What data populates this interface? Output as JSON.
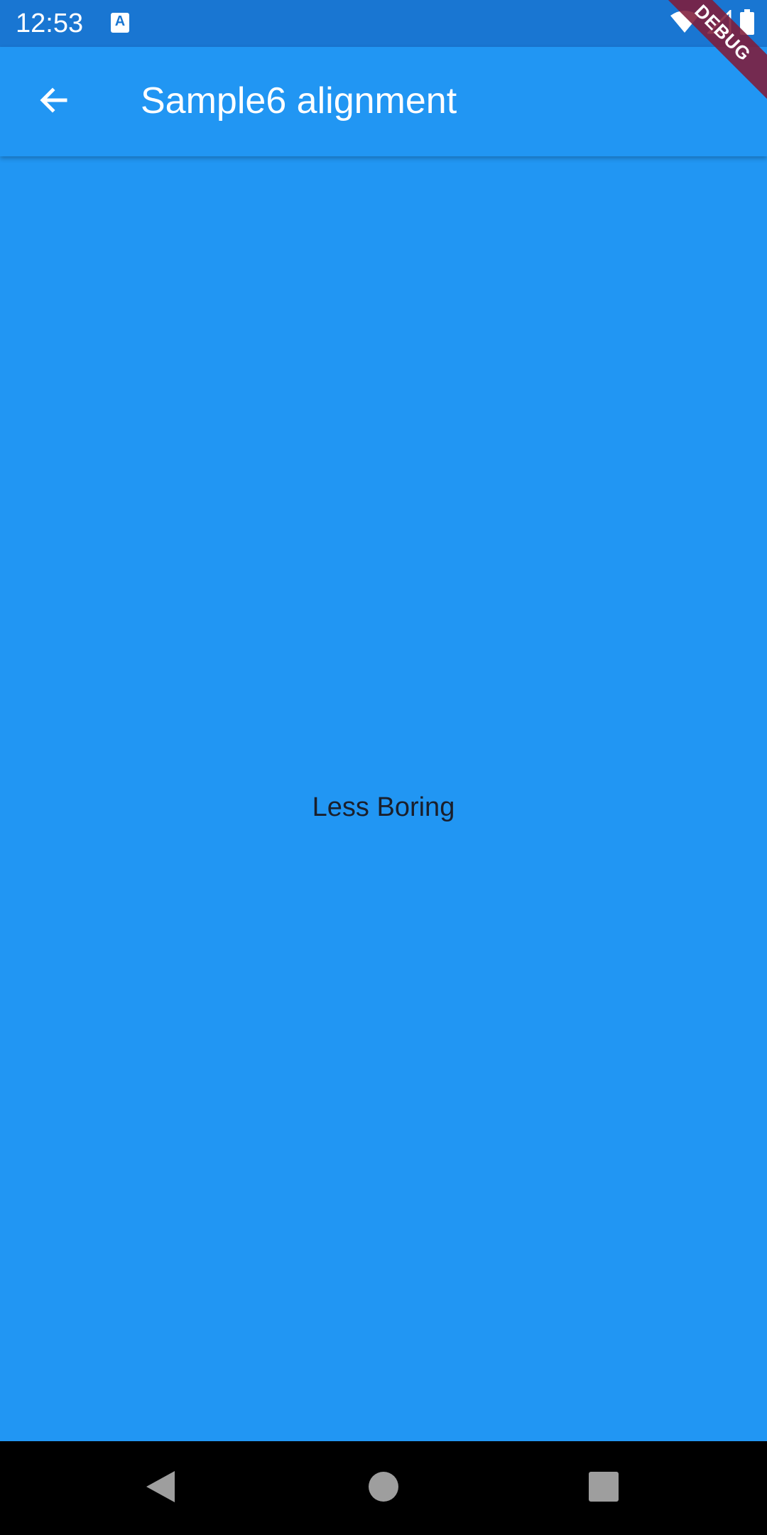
{
  "status_bar": {
    "time": "12:53",
    "notification_icon": "a-accessibility-icon",
    "icons": [
      "wifi-icon",
      "signal-icon",
      "battery-icon"
    ]
  },
  "app_bar": {
    "back_icon": "arrow-back-icon",
    "title": "Sample6 alignment"
  },
  "body": {
    "center_text": "Less Boring"
  },
  "debug_banner": {
    "label": "DEBUG"
  },
  "nav_bar": {
    "buttons": [
      "back-triangle-icon",
      "home-circle-icon",
      "recents-square-icon"
    ]
  },
  "colors": {
    "primary": "#2196F3",
    "status_bar": "#1976D2",
    "debug_banner": "#801B39",
    "nav_bar": "#000000"
  }
}
